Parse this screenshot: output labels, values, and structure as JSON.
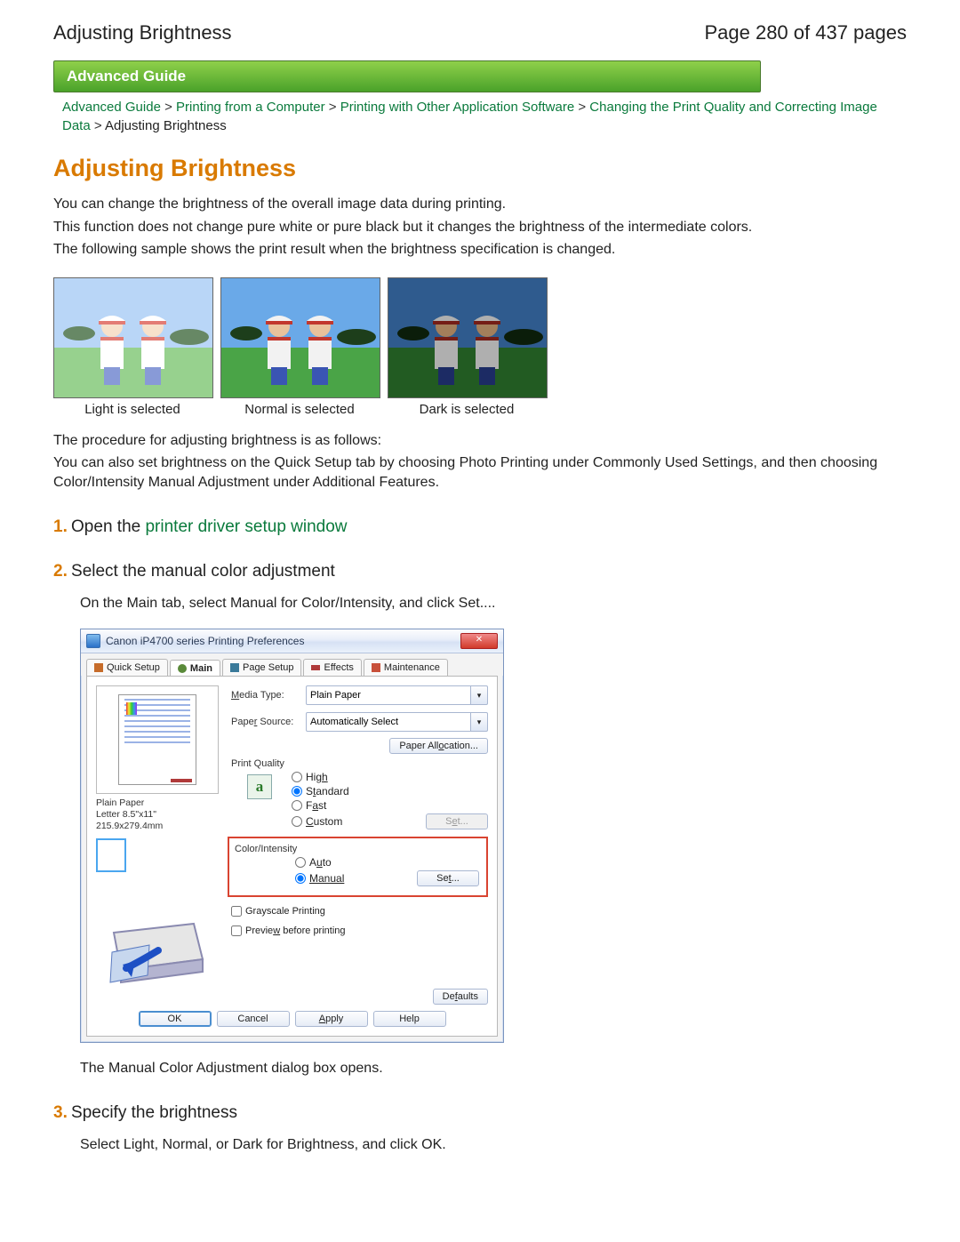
{
  "header": {
    "title": "Adjusting Brightness",
    "page_indicator": "Page 280 of 437 pages"
  },
  "banner": "Advanced Guide",
  "breadcrumbs": {
    "items": [
      {
        "label": "Advanced Guide",
        "link": true
      },
      {
        "label": "Printing from a Computer",
        "link": true
      },
      {
        "label": "Printing with Other Application Software",
        "link": true
      },
      {
        "label": "Changing the Print Quality and Correcting Image Data",
        "link": true
      },
      {
        "label": "Adjusting Brightness",
        "link": false
      }
    ],
    "sep": ">"
  },
  "article": {
    "heading": "Adjusting Brightness",
    "intro": [
      "You can change the brightness of the overall image data during printing.",
      "This function does not change pure white or pure black but it changes the brightness of the intermediate colors.",
      "The following sample shows the print result when the brightness specification is changed."
    ],
    "samples": [
      {
        "caption": "Light is selected"
      },
      {
        "caption": "Normal is selected"
      },
      {
        "caption": "Dark is selected"
      }
    ],
    "after_samples": [
      "The procedure for adjusting brightness is as follows:",
      "You can also set brightness on the Quick Setup tab by choosing Photo Printing under Commonly Used Settings, and then choosing Color/Intensity Manual Adjustment under Additional Features."
    ]
  },
  "steps": [
    {
      "num": "1.",
      "title_prefix": "Open the ",
      "title_link": "printer driver setup window",
      "body": []
    },
    {
      "num": "2.",
      "title_plain": "Select the manual color adjustment",
      "body": [
        "On the Main tab, select Manual for Color/Intensity, and click Set...."
      ],
      "closing": "The Manual Color Adjustment dialog box opens."
    },
    {
      "num": "3.",
      "title_plain": "Specify the brightness",
      "body": [
        "Select Light, Normal, or Dark for Brightness, and click OK."
      ]
    }
  ],
  "dialog": {
    "title": "Canon iP4700 series Printing Preferences",
    "tabs": [
      "Quick Setup",
      "Main",
      "Page Setup",
      "Effects",
      "Maintenance"
    ],
    "active_tab": "Main",
    "media_type_label": "Media Type:",
    "media_type_value": "Plain Paper",
    "paper_source_label": "Paper Source:",
    "paper_source_value": "Automatically Select",
    "paper_allocation_btn": "Paper Allocation...",
    "print_quality_label": "Print Quality",
    "quality_options": [
      "High",
      "Standard",
      "Fast",
      "Custom"
    ],
    "quality_selected": "Standard",
    "set_btn": "Set...",
    "color_intensity_label": "Color/Intensity",
    "ci_options": [
      "Auto",
      "Manual"
    ],
    "ci_selected": "Manual",
    "ci_set_btn": "Set...",
    "grayscale_label": "Grayscale Printing",
    "preview_label": "Preview before printing",
    "defaults_btn": "Defaults",
    "ok": "OK",
    "cancel": "Cancel",
    "apply": "Apply",
    "help": "Help",
    "paper_info": [
      "Plain Paper",
      "Letter 8.5\"x11\" 215.9x279.4mm"
    ]
  }
}
